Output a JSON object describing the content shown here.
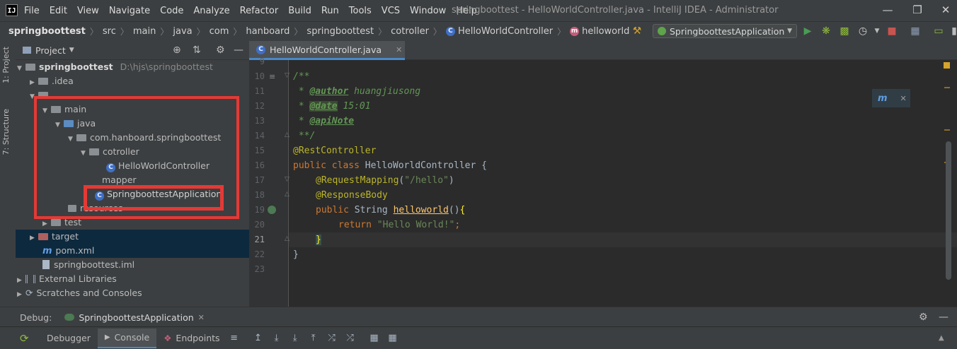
{
  "menubar": {
    "logo": "IJ",
    "items": [
      "File",
      "Edit",
      "View",
      "Navigate",
      "Code",
      "Analyze",
      "Refactor",
      "Build",
      "Run",
      "Tools",
      "VCS",
      "Window",
      "Help"
    ],
    "window_title": "springboottest - HelloWorldController.java - IntelliJ IDEA - Administrator"
  },
  "breadcrumb": {
    "items": [
      "springboottest",
      "src",
      "main",
      "java",
      "com",
      "hanboard",
      "springboottest",
      "cotroller",
      "HelloWorldController",
      "helloworld"
    ],
    "class_icon": "C",
    "method_icon": "m"
  },
  "toolbar": {
    "run_config": "SpringboottestApplication"
  },
  "left_strip": {
    "project_tab": "1: Project",
    "structure_tab": "7: Structure"
  },
  "project_panel": {
    "title": "Project",
    "tree": [
      {
        "label": "springboottest",
        "path": "D:\\hjs\\springboottest"
      },
      {
        "label": ".idea"
      },
      {
        "label": ""
      },
      {
        "label": "main"
      },
      {
        "label": "java"
      },
      {
        "label": "com.hanboard.springboottest"
      },
      {
        "label": "cotroller"
      },
      {
        "label": "HelloWorldController"
      },
      {
        "label": "mapper"
      },
      {
        "label": "SpringboottestApplication"
      },
      {
        "label": "resources"
      },
      {
        "label": "test"
      },
      {
        "label": "target"
      },
      {
        "label": "pom.xml"
      },
      {
        "label": "springboottest.iml"
      },
      {
        "label": "External Libraries"
      },
      {
        "label": "Scratches and Consoles"
      }
    ]
  },
  "editor": {
    "tab_label": "HelloWorldController.java",
    "line_numbers": [
      "9",
      "10",
      "11",
      "12",
      "13",
      "14",
      "15",
      "16",
      "17",
      "18",
      "19",
      "20",
      "21",
      "22",
      "23"
    ],
    "code": {
      "doc_open": "/**",
      "doc_star": " * ",
      "author_tag": "@author",
      "author_val": " huangjiusong",
      "date_tag": "@date",
      "date_val": " 15:01",
      "apinote_tag": "@apiNote",
      "doc_close": " **/",
      "rest_controller": "@RestController",
      "kw_public": "public",
      "kw_class": "class",
      "class_name": " HelloWorldController {",
      "request_mapping": "@RequestMapping",
      "request_mapping_args_open": "(",
      "request_mapping_str": "\"/hello\"",
      "request_mapping_args_close": ")",
      "response_body": "@ResponseBody",
      "ret_type": " String ",
      "method_name": "helloworld",
      "method_parens": "()",
      "brace_open": "{",
      "kw_return": "return",
      "return_str": "\"Hello World!\"",
      "semicolon": ";",
      "brace_close_inner": "}",
      "brace_close_outer": "}"
    }
  },
  "debug": {
    "label": "Debug:",
    "session": "SpringboottestApplication",
    "tabs": [
      "Debugger",
      "Console",
      "Endpoints"
    ]
  },
  "colors": {
    "accent": "#4a88c7",
    "highlight_box": "#e53935",
    "background": "#2b2b2b",
    "panel": "#3c3f41"
  }
}
